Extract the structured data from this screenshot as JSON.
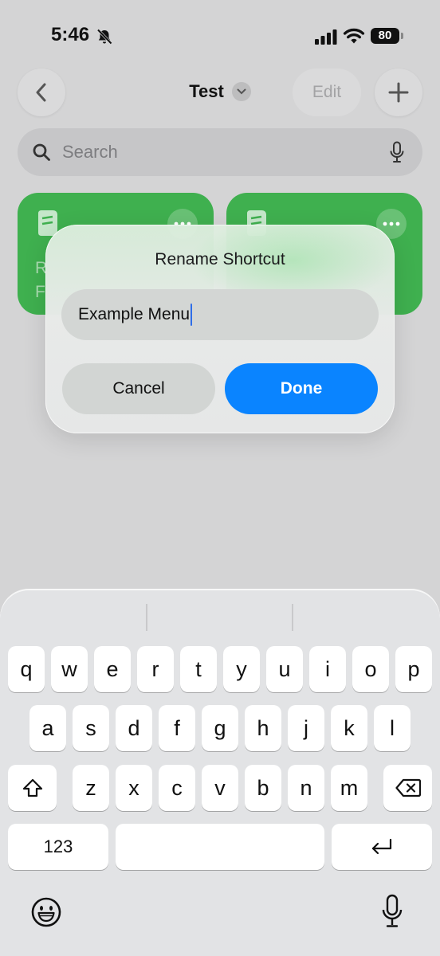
{
  "status_bar": {
    "time": "5:46",
    "battery": "80",
    "icons": [
      "bell-slash-icon",
      "cellular-signal-icon",
      "wifi-icon",
      "battery-icon"
    ]
  },
  "nav": {
    "title": "Test",
    "edit_label": "Edit",
    "icons": [
      "chevron-left-icon",
      "chevron-down-icon",
      "plus-icon"
    ]
  },
  "search": {
    "placeholder": "Search",
    "icons": [
      "search-icon",
      "microphone-icon"
    ]
  },
  "tiles": [
    {
      "partial_text": "R\nF",
      "color": "#3fb04f",
      "icon": "document-icon"
    },
    {
      "partial_text": "",
      "color": "#3fb04f",
      "icon": "document-icon"
    }
  ],
  "alert": {
    "title": "Rename Shortcut",
    "input_value": "Example Menu",
    "cancel_label": "Cancel",
    "done_label": "Done",
    "accent_color": "#0a84ff"
  },
  "keyboard": {
    "row1": [
      "q",
      "w",
      "e",
      "r",
      "t",
      "y",
      "u",
      "i",
      "o",
      "p"
    ],
    "row2": [
      "a",
      "s",
      "d",
      "f",
      "g",
      "h",
      "j",
      "k",
      "l"
    ],
    "row3": [
      "z",
      "x",
      "c",
      "v",
      "b",
      "n",
      "m"
    ],
    "numbers_label": "123",
    "icons": [
      "shift-icon",
      "delete-icon",
      "return-icon",
      "emoji-icon",
      "dictation-icon"
    ]
  }
}
